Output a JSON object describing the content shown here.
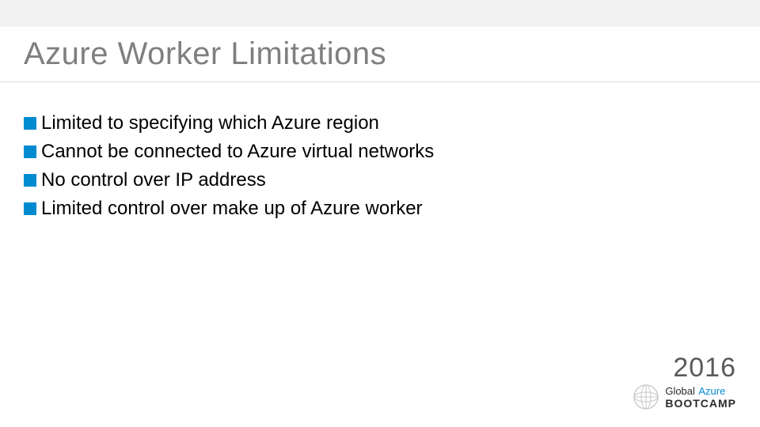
{
  "title": "Azure Worker Limitations",
  "bullets": [
    "Limited to specifying which Azure region",
    "Cannot be connected to Azure virtual networks",
    "No control over IP address",
    "Limited control over make up of Azure worker"
  ],
  "footer": {
    "year": "2016",
    "line1_a": "Global",
    "line1_b": "Azure",
    "line2": "BOOTCAMP"
  },
  "colors": {
    "accent": "#008bd0",
    "title_grey": "#7f7f7f",
    "top_bar": "#f2f2f2"
  }
}
